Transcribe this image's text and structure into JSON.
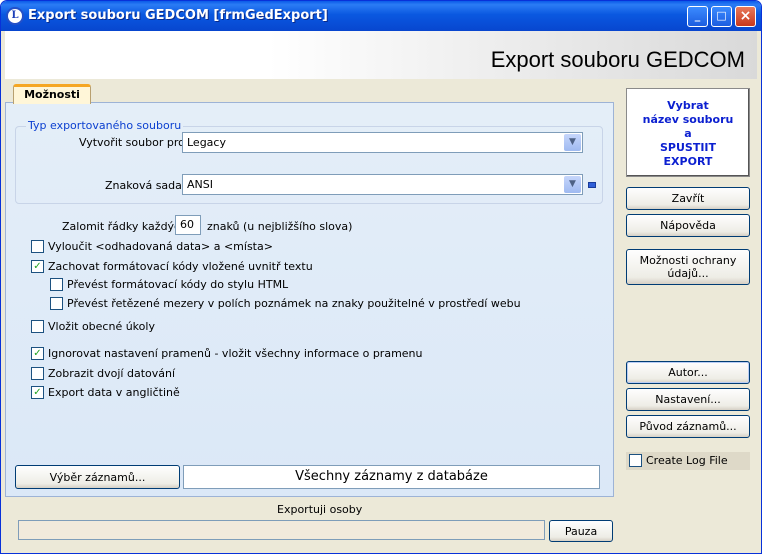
{
  "window": {
    "title": "Export souboru GEDCOM [frmGedExport]",
    "icon_letter": "L",
    "controls": {
      "minimize": "_",
      "maximize": "□",
      "close": "×"
    }
  },
  "header": {
    "title": "Export souboru GEDCOM"
  },
  "tabs": [
    {
      "label": "Možnosti",
      "active": true
    }
  ],
  "file_type_group": {
    "legend": "Typ exportovaného souboru",
    "create_for_label": "Vytvořit soubor pro:",
    "create_for_value": "Legacy",
    "charset_label": "Znaková sada:",
    "charset_value": "ANSI"
  },
  "wrap": {
    "prefix": "Zalomit řádky každých:",
    "value": "60",
    "suffix": "znaků (u nejbližšího slova)"
  },
  "options": [
    {
      "label": "Vyloučit <odhadovaná data> a <místa>",
      "checked": false
    },
    {
      "label": "Zachovat formátovací kódy vložené uvnitř textu",
      "checked": true
    },
    {
      "label": "Převést formátovací kódy do stylu HTML",
      "checked": false
    },
    {
      "label": "Převést řetězené mezery v polích poznámek na znaky použitelné v prostředí webu",
      "checked": false
    },
    {
      "label": "Vložit obecné úkoly",
      "checked": false
    },
    {
      "label": "Ignorovat nastavení pramenů - vložit všechny informace o pramenu",
      "checked": true
    },
    {
      "label": "Zobrazit dvojí datování",
      "checked": false
    },
    {
      "label": "Export data v angličtině",
      "checked": true
    }
  ],
  "records": {
    "select_button": "Výběr záznamů...",
    "display": "Všechny záznamy z databáze"
  },
  "right_panel": {
    "export_button_lines": [
      "Vybrat",
      "název souboru",
      "a",
      "SPUSTIIT",
      "EXPORT"
    ],
    "close_button": "Zavřít",
    "help_button": "Nápověda",
    "privacy_button_lines": [
      "Možnosti ochrany",
      "údajů..."
    ],
    "author_button": "Autor...",
    "settings_button": "Nastavení...",
    "origin_button": "Původ záznamů...",
    "create_log": {
      "label": "Create Log File",
      "checked": false
    }
  },
  "status": {
    "label": "Exportuji osoby",
    "progress": 0,
    "pause_button": "Pauza"
  },
  "colors": {
    "title_bar": "#0a58e0",
    "accent_tab": "#f5a623",
    "panel": "#dbe8f7",
    "export_text": "#0b1fd0"
  }
}
